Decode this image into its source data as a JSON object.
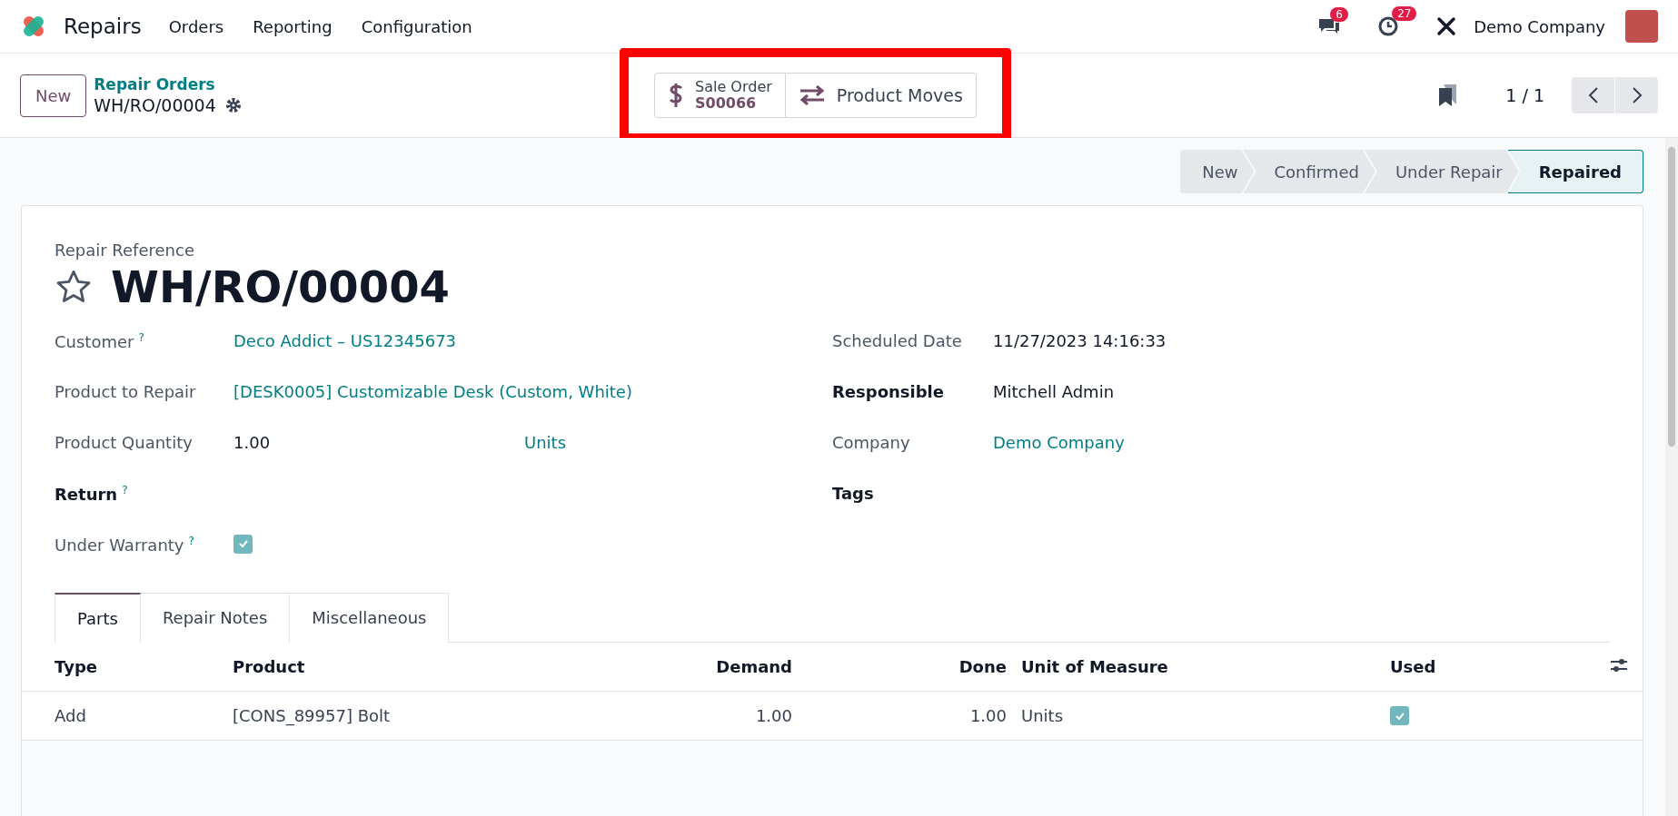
{
  "navbar": {
    "app_name": "Repairs",
    "menu": [
      "Orders",
      "Reporting",
      "Configuration"
    ],
    "messages_count": "6",
    "activities_count": "27",
    "company": "Demo Company"
  },
  "control_panel": {
    "new_button": "New",
    "breadcrumb": "Repair Orders",
    "record": "WH/RO/00004",
    "smart_buttons": [
      {
        "kind": "stat",
        "label": "Sale Order",
        "value": "S00066"
      },
      {
        "kind": "plain",
        "label": "Product Moves"
      }
    ],
    "pager": "1 / 1"
  },
  "status_steps": [
    {
      "label": "New",
      "selected": false
    },
    {
      "label": "Confirmed",
      "selected": false
    },
    {
      "label": "Under Repair",
      "selected": false
    },
    {
      "label": "Repaired",
      "selected": true
    }
  ],
  "form": {
    "reference_label": "Repair Reference",
    "title": "WH/RO/00004",
    "left_fields": [
      {
        "label": "Customer",
        "required": false,
        "help": "?",
        "kind": "link",
        "value": "Deco Addict – US12345673"
      },
      {
        "label": "Product to Repair",
        "required": false,
        "kind": "link",
        "value": "[DESK0005] Customizable Desk (Custom, White)"
      },
      {
        "label": "Product Quantity",
        "required": false,
        "kind": "quantity",
        "value": "1.00",
        "unit": "Units"
      },
      {
        "label": "Return",
        "required": true,
        "help": "?",
        "kind": "empty"
      },
      {
        "label": "Under Warranty",
        "required": false,
        "help": "?",
        "kind": "checkbox",
        "checked": true
      }
    ],
    "right_fields": [
      {
        "label": "Scheduled Date",
        "required": false,
        "kind": "text",
        "value": "11/27/2023 14:16:33"
      },
      {
        "label": "Responsible",
        "required": true,
        "kind": "text",
        "value": "Mitchell Admin"
      },
      {
        "label": "Company",
        "required": false,
        "kind": "link",
        "value": "Demo Company"
      },
      {
        "label": "Tags",
        "required": true,
        "kind": "empty"
      }
    ],
    "tabs": [
      {
        "label": "Parts",
        "selected": true
      },
      {
        "label": "Repair Notes",
        "selected": false
      },
      {
        "label": "Miscellaneous",
        "selected": false
      }
    ],
    "table": {
      "columns": [
        "Type",
        "Product",
        "Demand",
        "Done",
        "Unit of Measure",
        "Used"
      ],
      "rows": [
        {
          "type": "Add",
          "product": "[CONS_89957] Bolt",
          "demand": "1.00",
          "done": "1.00",
          "uom": "Units",
          "used": true
        }
      ]
    }
  }
}
